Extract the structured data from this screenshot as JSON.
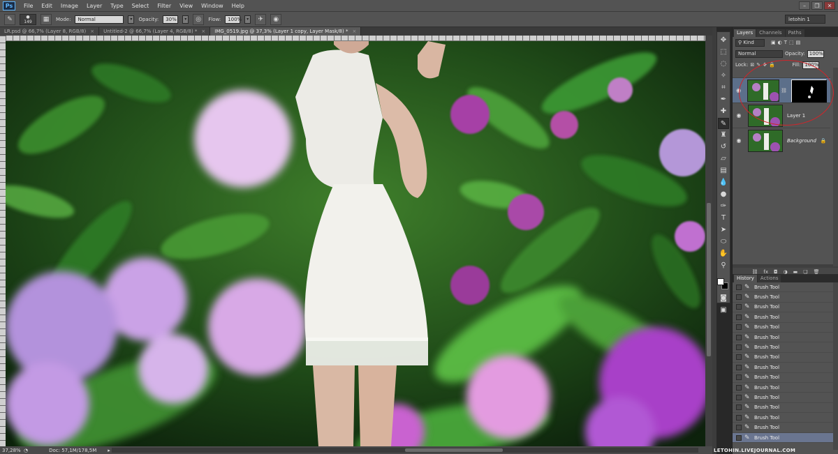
{
  "menubar": {
    "logo": "Ps",
    "items": [
      "File",
      "Edit",
      "Image",
      "Layer",
      "Type",
      "Select",
      "Filter",
      "View",
      "Window",
      "Help"
    ]
  },
  "options": {
    "brush_size": "149",
    "mode_label": "Mode:",
    "mode_value": "Normal",
    "opacity_label": "Opacity:",
    "opacity_value": "30%",
    "flow_label": "Flow:",
    "flow_value": "100%",
    "workspace": "letohin 1"
  },
  "tabs": [
    {
      "label": "LR.psd @ 66,7% (Layer 8, RGB/8)",
      "active": false
    },
    {
      "label": "Untitled-2 @ 66,7% (Layer 4, RGB/8) *",
      "active": false
    },
    {
      "label": "IMG_0519.jpg @ 37,3% (Layer 1 copy, Layer Mask/8) *",
      "active": true
    }
  ],
  "status": {
    "zoom": "37,28%",
    "doc": "Doc: 57,1M/178,5M"
  },
  "layers_panel": {
    "tabs": [
      "Layers",
      "Channels",
      "Paths"
    ],
    "kind": "Kind",
    "blend_mode": "Normal",
    "opacity_label": "Opacity:",
    "opacity_value": "100%",
    "lock_label": "Lock:",
    "fill_label": "Fill:",
    "fill_value": "100%",
    "layers": [
      {
        "name": "",
        "selected": true,
        "has_mask": true
      },
      {
        "name": "Layer 1",
        "selected": false,
        "has_mask": false
      },
      {
        "name": "Background",
        "selected": false,
        "has_mask": false,
        "italic": true,
        "locked": true
      }
    ]
  },
  "history_panel": {
    "tabs": [
      "History",
      "Actions"
    ],
    "items": [
      "Brush Tool",
      "Brush Tool",
      "Brush Tool",
      "Brush Tool",
      "Brush Tool",
      "Brush Tool",
      "Brush Tool",
      "Brush Tool",
      "Brush Tool",
      "Brush Tool",
      "Brush Tool",
      "Brush Tool",
      "Brush Tool",
      "Brush Tool",
      "Brush Tool",
      "Brush Tool"
    ]
  },
  "watermark": "LETOHIN.LIVEJOURNAL.COM",
  "colors": {
    "foreground": "#ffffff",
    "background": "#000000",
    "annotation": "#d0252a"
  }
}
